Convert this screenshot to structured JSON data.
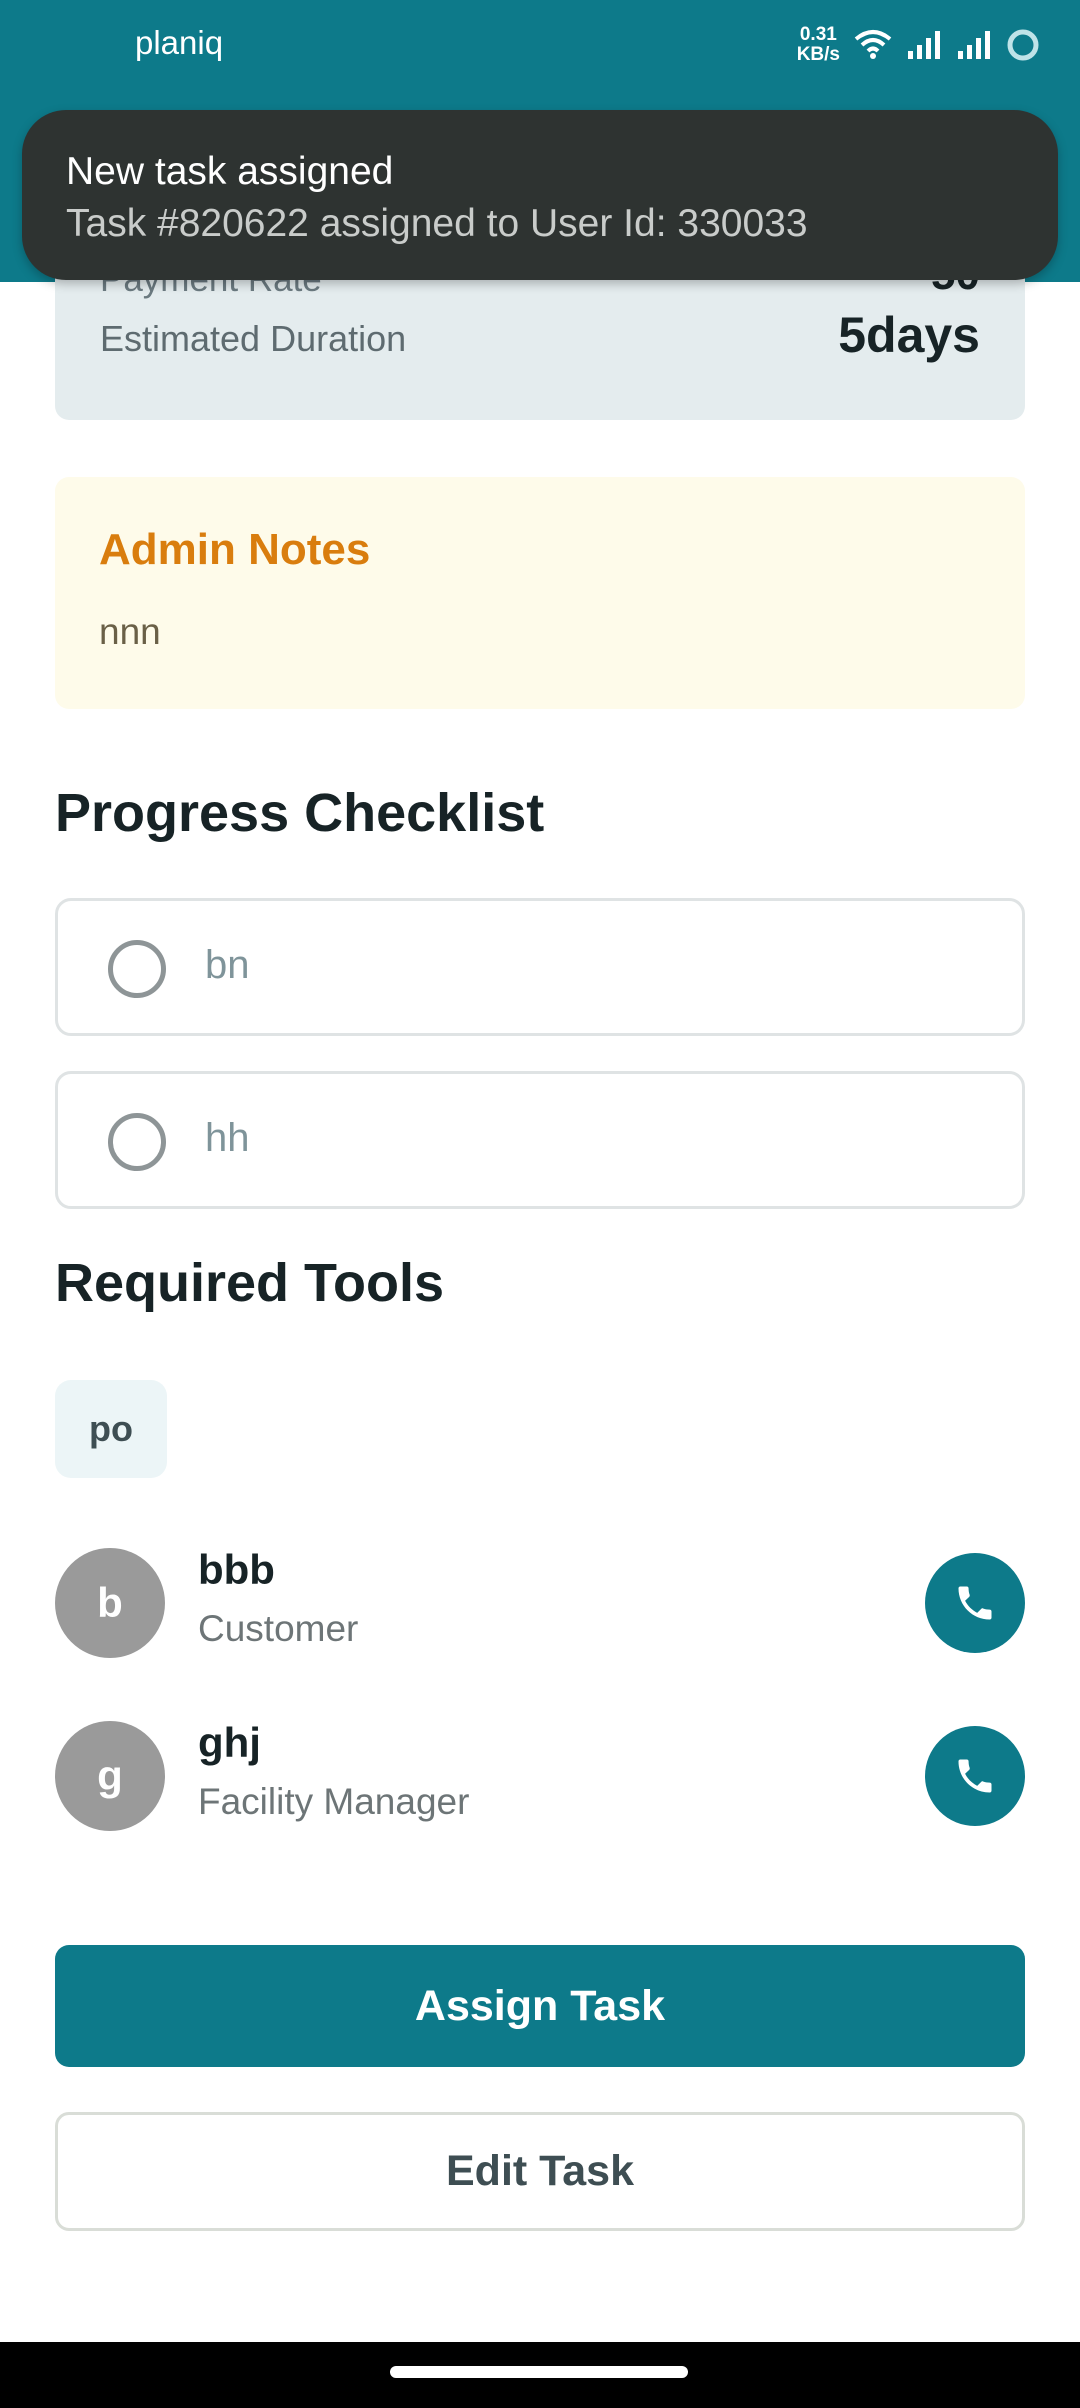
{
  "status_bar": {
    "app_name": "planiq",
    "net_speed_value": "0.31",
    "net_speed_unit": "KB/s"
  },
  "toast": {
    "title": "New task assigned",
    "message": "Task #820622 assigned to User Id: 330033"
  },
  "details": {
    "hidden_row_label": "Payment Rate",
    "hidden_row_value": "50",
    "duration_label": "Estimated Duration",
    "duration_value": "5days"
  },
  "admin_notes": {
    "title": "Admin Notes",
    "text": "nnn"
  },
  "checklist": {
    "title": "Progress Checklist",
    "items": [
      {
        "label": "bn",
        "checked": false
      },
      {
        "label": "hh",
        "checked": false
      }
    ]
  },
  "tools": {
    "title": "Required Tools",
    "items": [
      "po"
    ]
  },
  "contacts": [
    {
      "initial": "b",
      "name": "bbb",
      "role": "Customer"
    },
    {
      "initial": "g",
      "name": "ghj",
      "role": "Facility Manager"
    }
  ],
  "actions": {
    "assign_label": "Assign Task",
    "edit_label": "Edit Task"
  },
  "colors": {
    "primary": "#0d7a8a",
    "admin_notes_bg": "#fefbea",
    "admin_notes_title": "#d97d0e",
    "toast_bg": "#2e3331"
  }
}
